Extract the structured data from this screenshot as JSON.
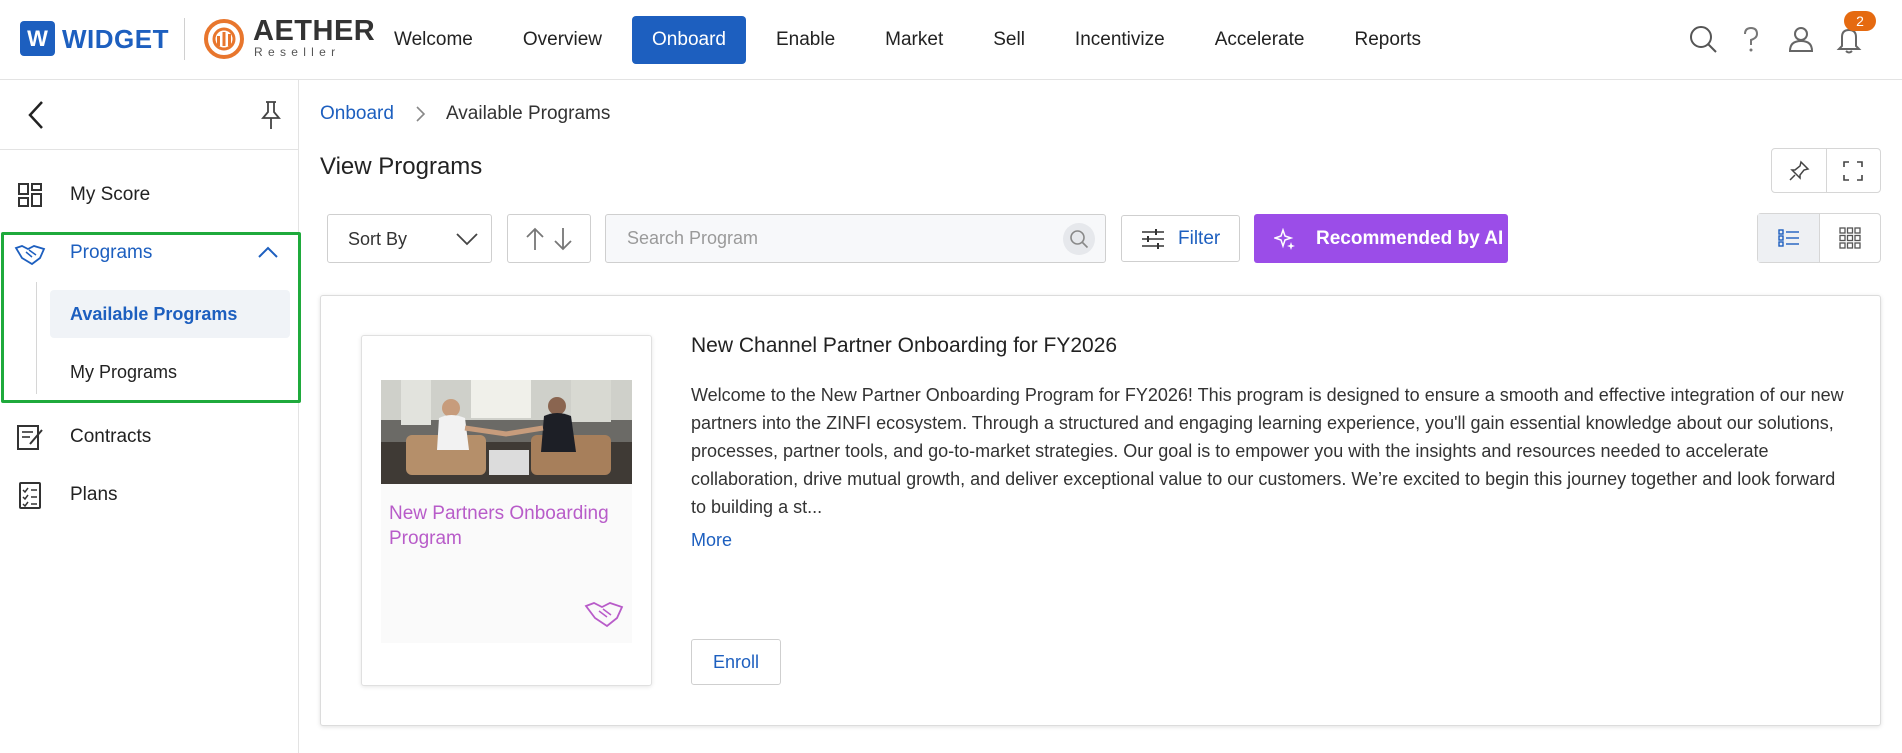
{
  "brand": {
    "w_letter": "W",
    "name": "WIDGET",
    "partner_name": "AETHER",
    "partner_sub": "Reseller",
    "primary_color": "#1d5fbf",
    "partner_color": "#e8762d"
  },
  "nav": {
    "items": [
      {
        "label": "Welcome",
        "active": false
      },
      {
        "label": "Overview",
        "active": false
      },
      {
        "label": "Onboard",
        "active": true
      },
      {
        "label": "Enable",
        "active": false
      },
      {
        "label": "Market",
        "active": false
      },
      {
        "label": "Sell",
        "active": false
      },
      {
        "label": "Incentivize",
        "active": false
      },
      {
        "label": "Accelerate",
        "active": false
      },
      {
        "label": "Reports",
        "active": false
      }
    ],
    "icons": [
      "search-icon",
      "help-icon",
      "user-icon",
      "bell-icon"
    ],
    "notification_count": "2"
  },
  "sidebar": {
    "items": [
      {
        "label": "My Score",
        "icon": "dashboard-icon"
      },
      {
        "label": "Programs",
        "icon": "handshake-icon",
        "expanded": true,
        "children": [
          {
            "label": "Available Programs",
            "active": true
          },
          {
            "label": "My Programs",
            "active": false
          }
        ]
      },
      {
        "label": "Contracts",
        "icon": "contract-icon"
      },
      {
        "label": "Plans",
        "icon": "checklist-icon"
      }
    ],
    "highlight_color": "#1faa3c"
  },
  "breadcrumb": {
    "root": "Onboard",
    "current": "Available Programs"
  },
  "page": {
    "title": "View Programs"
  },
  "toolbar": {
    "sort_label": "Sort By",
    "search_placeholder": "Search Program",
    "filter_label": "Filter",
    "ai_label": "Recommended by AI",
    "ai_color": "#9b4de8"
  },
  "program": {
    "title": "New Channel Partner Onboarding for FY2026",
    "description": "Welcome to the New Partner Onboarding Program for FY2026! This program is designed to ensure a smooth and effective integration of our new partners into the ZINFI ecosystem. Through a structured and engaging learning experience, you'll gain essential knowledge about our solutions, processes, partner tools, and go-to-market strategies. Our goal is to empower you with the insights and resources needed to accelerate collaboration, drive mutual growth, and deliver exceptional value to our customers. We’re excited to begin this journey together and look forward to building a st...",
    "more_label": "More",
    "enroll_label": "Enroll",
    "thumbnail_title": "New Partners Onboarding Program",
    "thumbnail_title_color": "#b85cc9"
  }
}
